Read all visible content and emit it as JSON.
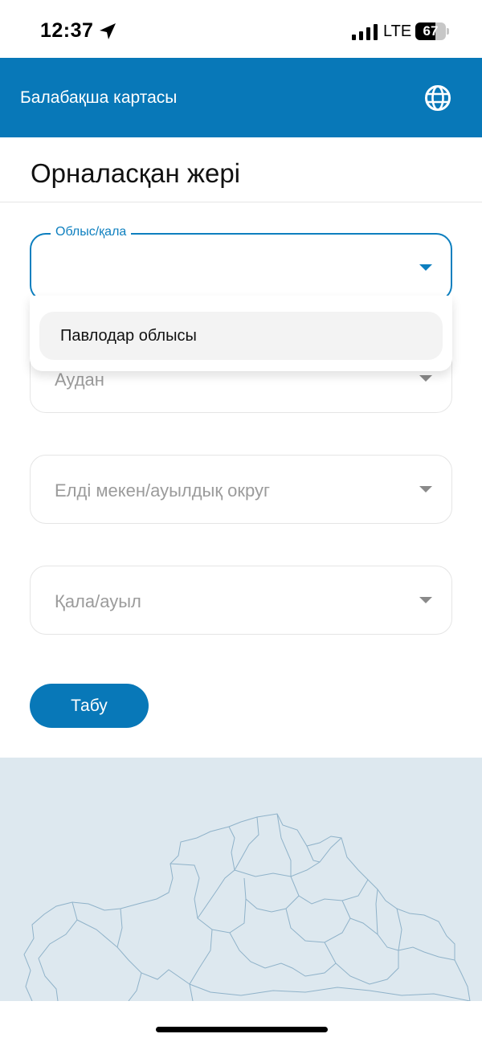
{
  "status_bar": {
    "time": "12:37",
    "network": "LTE",
    "battery_level": "67",
    "battery_percent": 67
  },
  "app_bar": {
    "title": "Балабақша картасы",
    "language_icon": "globe-icon",
    "color": "#0878b8"
  },
  "page": {
    "title": "Орналасқан жері"
  },
  "form": {
    "region": {
      "label": "Облыс/қала",
      "value": "",
      "options": [
        "Павлодар облысы"
      ]
    },
    "district": {
      "placeholder": "Аудан"
    },
    "settlement": {
      "placeholder": "Елді мекен/ауылдық округ"
    },
    "city": {
      "placeholder": "Қала/ауыл"
    },
    "search_label": "Табу"
  },
  "colors": {
    "primary": "#0878b8",
    "focus": "#0d7fbf",
    "map_background": "#dde8ef",
    "map_border": "#8fb2c9"
  }
}
